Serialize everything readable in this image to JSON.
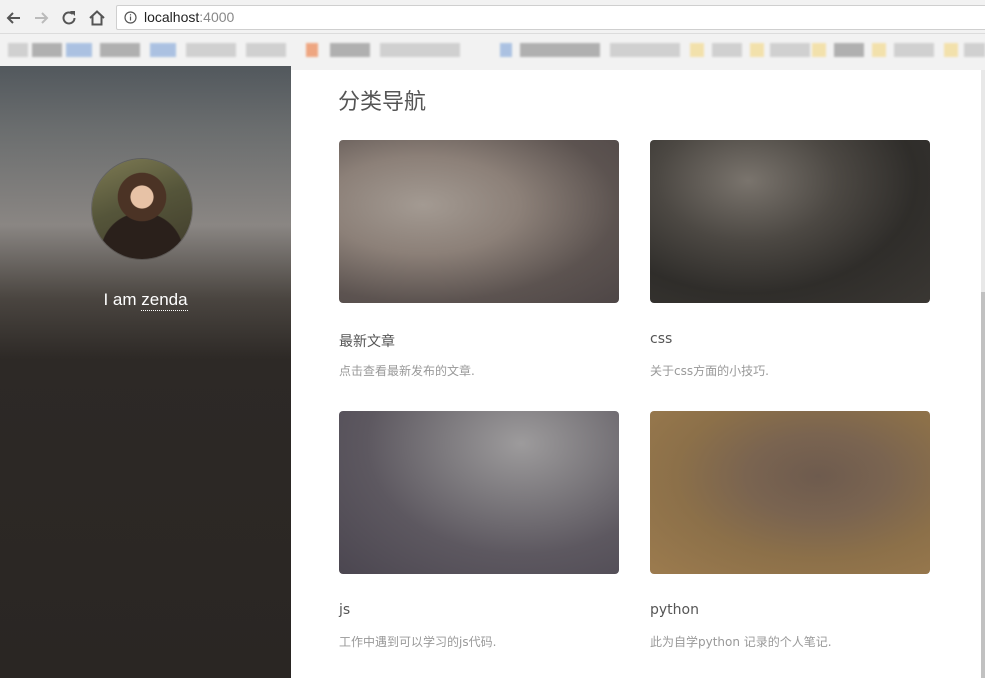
{
  "browser": {
    "url_host": "localhost",
    "url_port": ":4000"
  },
  "sidebar": {
    "tagline_prefix": "I am ",
    "tagline_name": "zenda"
  },
  "main": {
    "title": "分类导航",
    "cards": [
      {
        "title": "最新文章",
        "desc": "点击查看最新发布的文章."
      },
      {
        "title": "css",
        "desc": "关于css方面的小技巧."
      },
      {
        "title": "js",
        "desc": "工作中遇到可以学习的js代码."
      },
      {
        "title": "python",
        "desc": "此为自学python 记录的个人笔记."
      }
    ]
  }
}
